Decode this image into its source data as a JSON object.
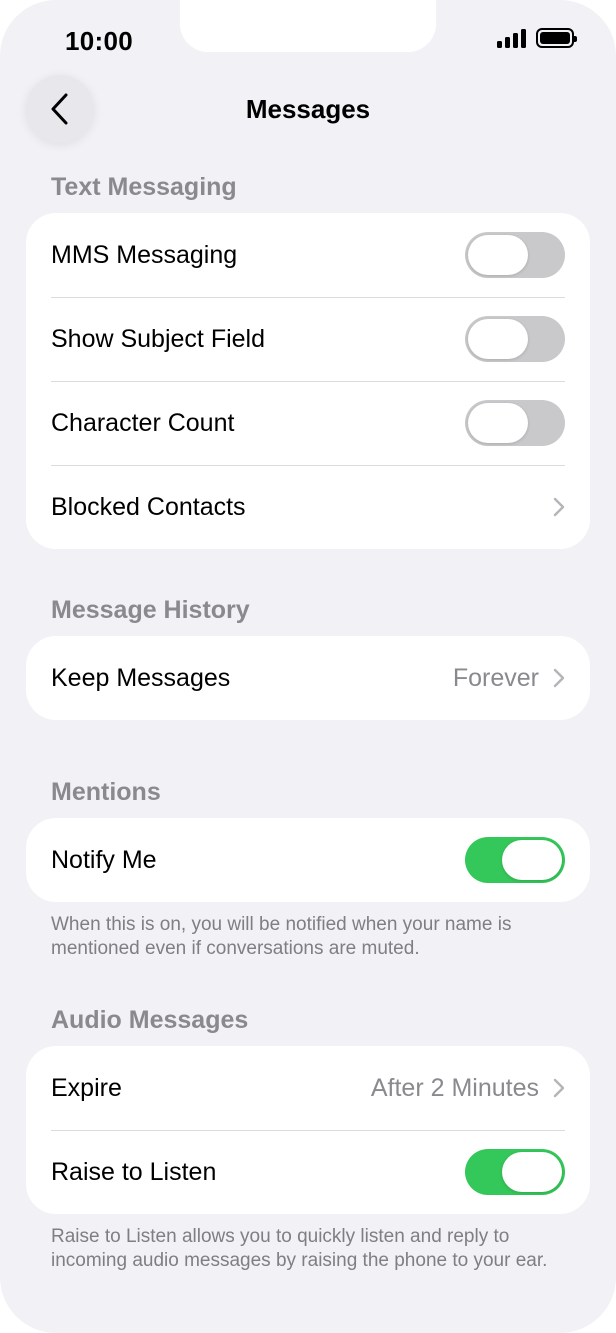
{
  "status_bar": {
    "time": "10:00"
  },
  "nav": {
    "title": "Messages"
  },
  "text_messaging": {
    "header": "Text Messaging",
    "rows": [
      {
        "label": "MMS Messaging",
        "toggle": false
      },
      {
        "label": "Show Subject Field",
        "toggle": false
      },
      {
        "label": "Character Count",
        "toggle": false
      },
      {
        "label": "Blocked Contacts"
      }
    ]
  },
  "message_history": {
    "header": "Message History",
    "keep_messages": {
      "label": "Keep Messages",
      "value": "Forever"
    }
  },
  "mentions": {
    "header": "Mentions",
    "notify_me": {
      "label": "Notify Me",
      "toggle": true
    },
    "footer": "When this is on, you will be notified when your name is mentioned even if conversations are muted."
  },
  "audio_messages": {
    "header": "Audio Messages",
    "expire": {
      "label": "Expire",
      "value": "After 2 Minutes"
    },
    "raise_to_listen": {
      "label": "Raise to Listen",
      "toggle": true
    },
    "footer": "Raise to Listen allows you to quickly listen and reply to incoming audio messages by raising the phone to your ear."
  },
  "colors": {
    "background": "#F1F1F6",
    "toggle_on": "#34C759",
    "toggle_off": "#C9C9CB",
    "secondary_text": "#8A8A8E"
  },
  "icons": [
    "back-chevron-icon",
    "chevron-right-icon",
    "signal-icon",
    "battery-icon"
  ]
}
